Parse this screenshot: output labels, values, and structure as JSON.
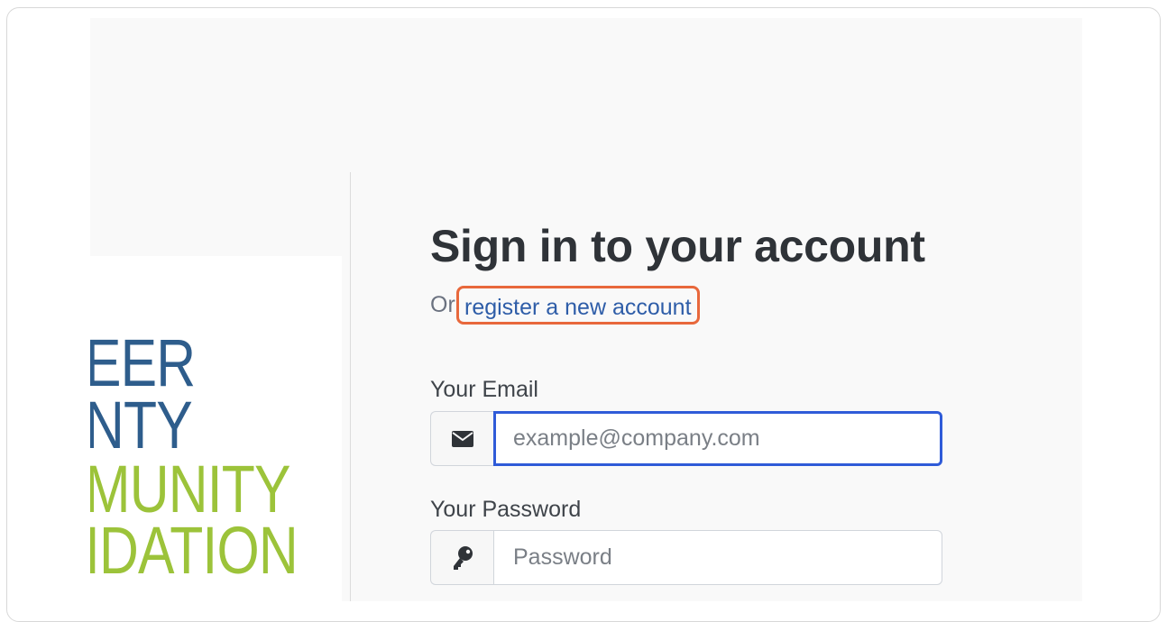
{
  "auth": {
    "title": "Sign in to your account",
    "subtitle_prefix": "Or",
    "register_link": "register a new account",
    "email_label": "Your Email",
    "email_placeholder": "example@company.com",
    "email_icon": "envelope-icon",
    "password_label": "Your Password",
    "password_placeholder": "Password",
    "password_icon": "key-icon"
  },
  "logo": {
    "lines": [
      "EER",
      "NTY",
      "MUNITY",
      "IDATION"
    ],
    "colors": {
      "blue": "#2e5d8c",
      "green": "#9cc33a"
    }
  },
  "colors": {
    "accent_highlight": "#e8683c",
    "link": "#2e5da8",
    "focus_border": "#2f5bd8"
  }
}
